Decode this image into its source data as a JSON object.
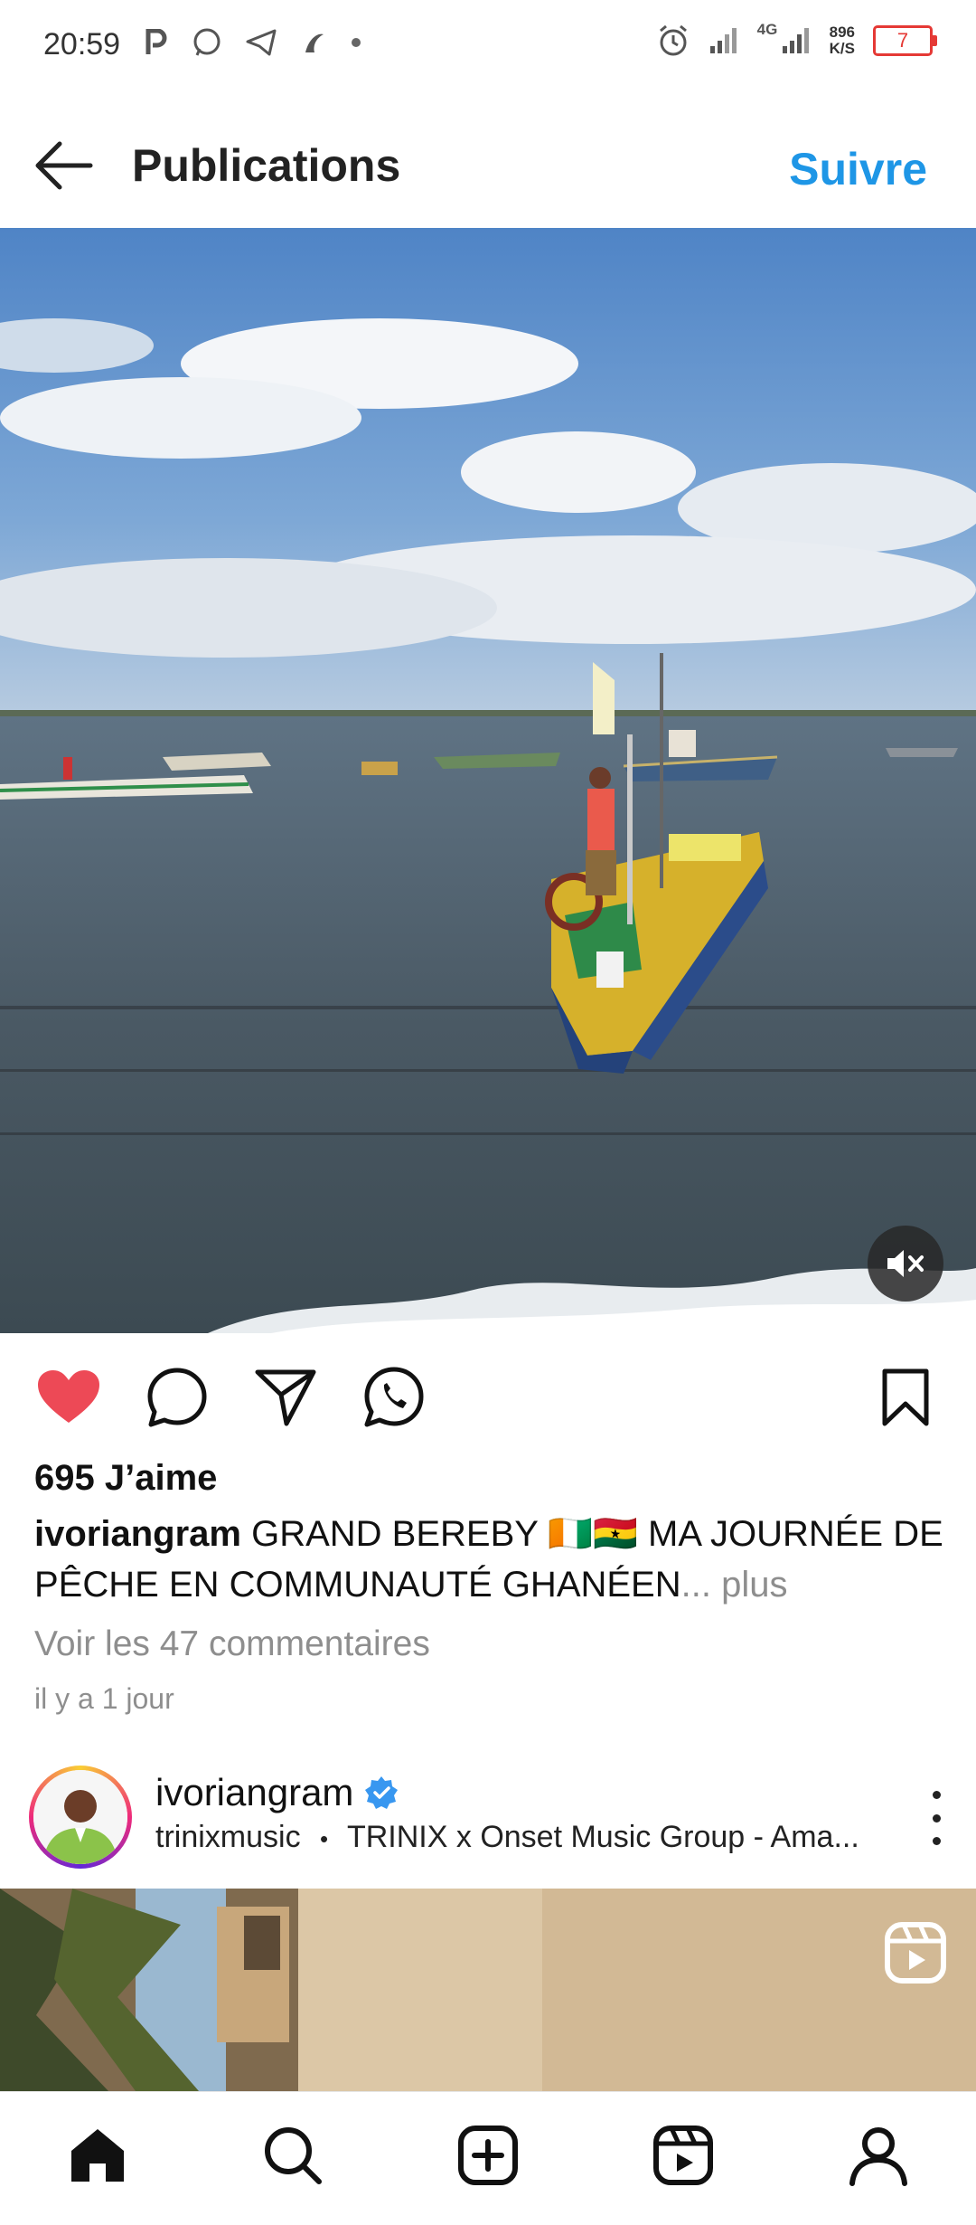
{
  "status_bar": {
    "time": "20:59",
    "network_label": "4G",
    "speed_value": "896",
    "speed_unit": "K/S",
    "battery_level": "7"
  },
  "header": {
    "title": "Publications",
    "follow_label": "Suivre"
  },
  "post": {
    "likes": "695 J’aime",
    "username": "ivoriangram",
    "caption_text": " GRAND BEREBY 🇨🇮🇬🇭 MA JOURNÉE DE PÊCHE EN COMMUNAUTÉ GHANÉEN",
    "caption_more": "... plus",
    "comments_link": "Voir les 47 commentaires",
    "date": "il y a 1 jour",
    "liked": true,
    "muted": true
  },
  "next_post": {
    "username": "ivoriangram",
    "verified": true,
    "subtitle_user": "trinixmusic",
    "subtitle_separator": "•",
    "subtitle_audio": "TRINIX x Onset Music Group - Ama..."
  },
  "bottom_nav": {
    "items": [
      "home-icon",
      "search-icon",
      "create-icon",
      "reels-icon",
      "profile-icon"
    ],
    "active": "home-icon"
  },
  "colors": {
    "accent": "#1e96e6",
    "like": "#ed4956",
    "battery": "#e53935"
  }
}
